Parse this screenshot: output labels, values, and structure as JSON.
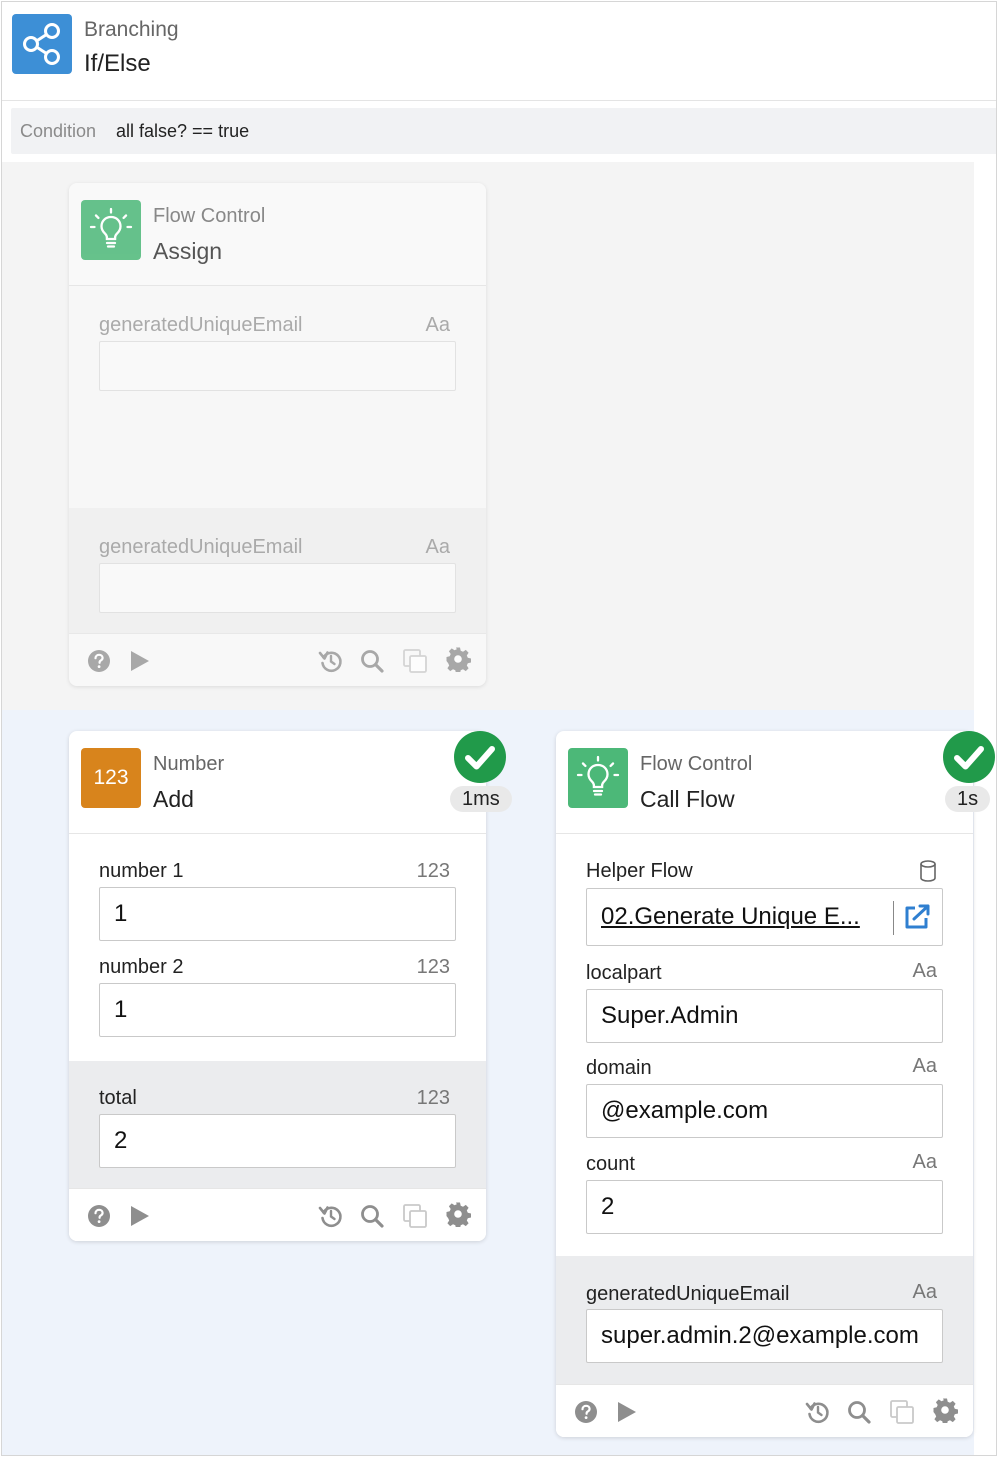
{
  "header": {
    "category": "Branching",
    "title": "If/Else",
    "icon": "share-icon",
    "icon_color": "#3d8fd6"
  },
  "condition": {
    "label": "Condition",
    "expression": "all false? == true"
  },
  "assign_card": {
    "category": "Flow Control",
    "title": "Assign",
    "icon": "lightbulb-icon",
    "disabled": true,
    "input": {
      "label": "generatedUniqueEmail",
      "type": "Aa",
      "value": ""
    },
    "output": {
      "label": "generatedUniqueEmail",
      "type": "Aa",
      "value": ""
    }
  },
  "add_card": {
    "category": "Number",
    "title": "Add",
    "icon_text": "123",
    "icon_color": "#d8841c",
    "status": "success",
    "duration": "1ms",
    "inputs": [
      {
        "label": "number 1",
        "type": "123",
        "value": "1"
      },
      {
        "label": "number 2",
        "type": "123",
        "value": "1"
      }
    ],
    "output": {
      "label": "total",
      "type": "123",
      "value": "2"
    }
  },
  "callflow_card": {
    "category": "Flow Control",
    "title": "Call Flow",
    "icon": "lightbulb-icon",
    "status": "success",
    "duration": "1s",
    "helper": {
      "label": "Helper Flow",
      "value": "02.Generate Unique E..."
    },
    "inputs": [
      {
        "label": "localpart",
        "type": "Aa",
        "value": "Super.Admin"
      },
      {
        "label": "domain",
        "type": "Aa",
        "value": "@example.com"
      },
      {
        "label": "count",
        "type": "Aa",
        "value": "2"
      }
    ],
    "output": {
      "label": "generatedUniqueEmail",
      "type": "Aa",
      "value": "super.admin.2@example.com"
    }
  },
  "colors": {
    "success": "#219a4a",
    "flow_control_icon": "#4cb878",
    "link_icon": "#2f7fd0"
  }
}
